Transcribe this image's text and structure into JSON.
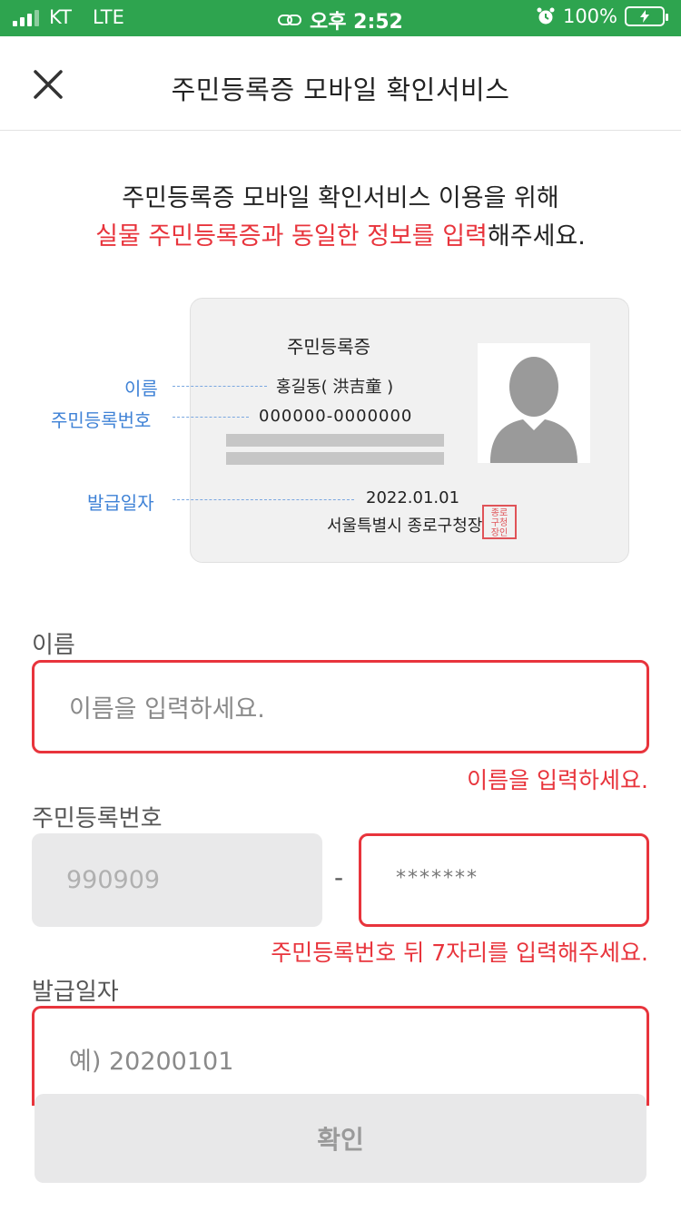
{
  "status_bar": {
    "carrier": "KT",
    "network": "LTE",
    "time": "오후 2:52",
    "battery": "100%"
  },
  "header": {
    "title": "주민등록증 모바일 확인서비스"
  },
  "intro": {
    "line1": "주민등록증 모바일 확인서비스 이용을 위해",
    "line2_highlight": "실물 주민등록증과 동일한 정보를 입력",
    "line2_rest": "해주세요."
  },
  "card": {
    "title": "주민등록증",
    "name": "홍길동( 洪吉童 )",
    "rrn": "000000-0000000",
    "issue_date": "2022.01.01",
    "issuer": "서울특별시 종로구청장",
    "seal_text": "종로구청장인",
    "labels": {
      "name": "이름",
      "rrn": "주민등록번호",
      "issue_date": "발급일자"
    }
  },
  "form": {
    "name": {
      "label": "이름",
      "placeholder": "이름을 입력하세요.",
      "error": "이름을 입력하세요."
    },
    "rrn": {
      "label": "주민등록번호",
      "front_value": "990909",
      "separator": "-",
      "back_placeholder": "*******",
      "error": "주민등록번호 뒤 7자리를 입력해주세요."
    },
    "issue_date": {
      "label": "발급일자",
      "placeholder": "예) 20200101"
    },
    "confirm_label": "확인"
  },
  "colors": {
    "status_bar": "#2ea44f",
    "accent_red": "#e8343c",
    "label_blue": "#3f82d6"
  }
}
